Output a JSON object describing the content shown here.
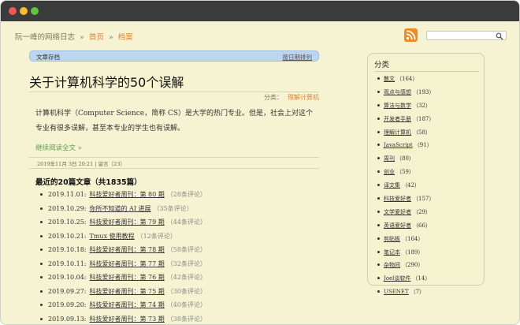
{
  "breadcrumb": {
    "site": "阮一峰的网络日志",
    "home": "首页",
    "current": "档案",
    "separator": "»"
  },
  "archive_bar": {
    "label": "文章存档",
    "sort_link": "按日期排列"
  },
  "post": {
    "title": "关于计算机科学的50个误解",
    "category_label": "分类：",
    "category": "理解计算机",
    "excerpt": "计算机科学（Computer Science，简称 CS）是大学的热门专业。但是，社会上对这个专业有很多误解，甚至本专业的学生也有误解。",
    "read_more": "继续阅读全文 »",
    "meta": "2019年11月 3日 20:21 | 留言（23）"
  },
  "recent": {
    "title": "最近的20篇文章（共1835篇）",
    "items": [
      {
        "date": "2019.11.01:",
        "title": "科技爱好者周刊：第 80 期",
        "comments": "（28条评论）"
      },
      {
        "date": "2019.10.29:",
        "title": "你所不知道的 AI 进展",
        "comments": "（35条评论）"
      },
      {
        "date": "2019.10.25:",
        "title": "科技爱好者周刊：第 79 期",
        "comments": "（44条评论）"
      },
      {
        "date": "2019.10.21:",
        "title": "Tmux 使用教程",
        "comments": "（12条评论）"
      },
      {
        "date": "2019.10.18:",
        "title": "科技爱好者周刊：第 78 期",
        "comments": "（58条评论）"
      },
      {
        "date": "2019.10.11:",
        "title": "科技爱好者周刊：第 77 期",
        "comments": "（32条评论）"
      },
      {
        "date": "2019.10.04:",
        "title": "科技爱好者周刊：第 76 期",
        "comments": "（42条评论）"
      },
      {
        "date": "2019.09.27:",
        "title": "科技爱好者周刊：第 75 期",
        "comments": "（30条评论）"
      },
      {
        "date": "2019.09.20:",
        "title": "科技爱好者周刊：第 74 期",
        "comments": "（40条评论）"
      },
      {
        "date": "2019.09.13:",
        "title": "科技爱好者周刊：第 73 期",
        "comments": "（38条评论）"
      }
    ]
  },
  "sidebar": {
    "title": "分类",
    "categories": [
      {
        "name": "散文",
        "count": "（164）"
      },
      {
        "name": "观点与感想",
        "count": "（193）"
      },
      {
        "name": "算法与数学",
        "count": "（32）"
      },
      {
        "name": "开发者手册",
        "count": "（187）"
      },
      {
        "name": "理解计算机",
        "count": "（58）"
      },
      {
        "name": "JavaScript",
        "count": "（91）"
      },
      {
        "name": "周刊",
        "count": "（80）"
      },
      {
        "name": "创业",
        "count": "（59）"
      },
      {
        "name": "译文集",
        "count": "（42）"
      },
      {
        "name": "科技爱好者",
        "count": "（157）"
      },
      {
        "name": "文学爱好者",
        "count": "（29）"
      },
      {
        "name": "英语爱好者",
        "count": "（66）"
      },
      {
        "name": "剪贴板",
        "count": "（164）"
      },
      {
        "name": "笔记本",
        "count": "（189）"
      },
      {
        "name": "杂物间",
        "count": "（290）"
      },
      {
        "name": "Joel谈软件",
        "count": "（14）"
      },
      {
        "name": "USENET",
        "count": "（7）"
      }
    ]
  },
  "colors": {
    "accent": "#d8843c",
    "background": "#f6f3d2",
    "archive_bar": "#bcd6f0",
    "rss": "#f08a24"
  },
  "icons": {
    "rss": "rss-icon",
    "search": "search-icon"
  }
}
